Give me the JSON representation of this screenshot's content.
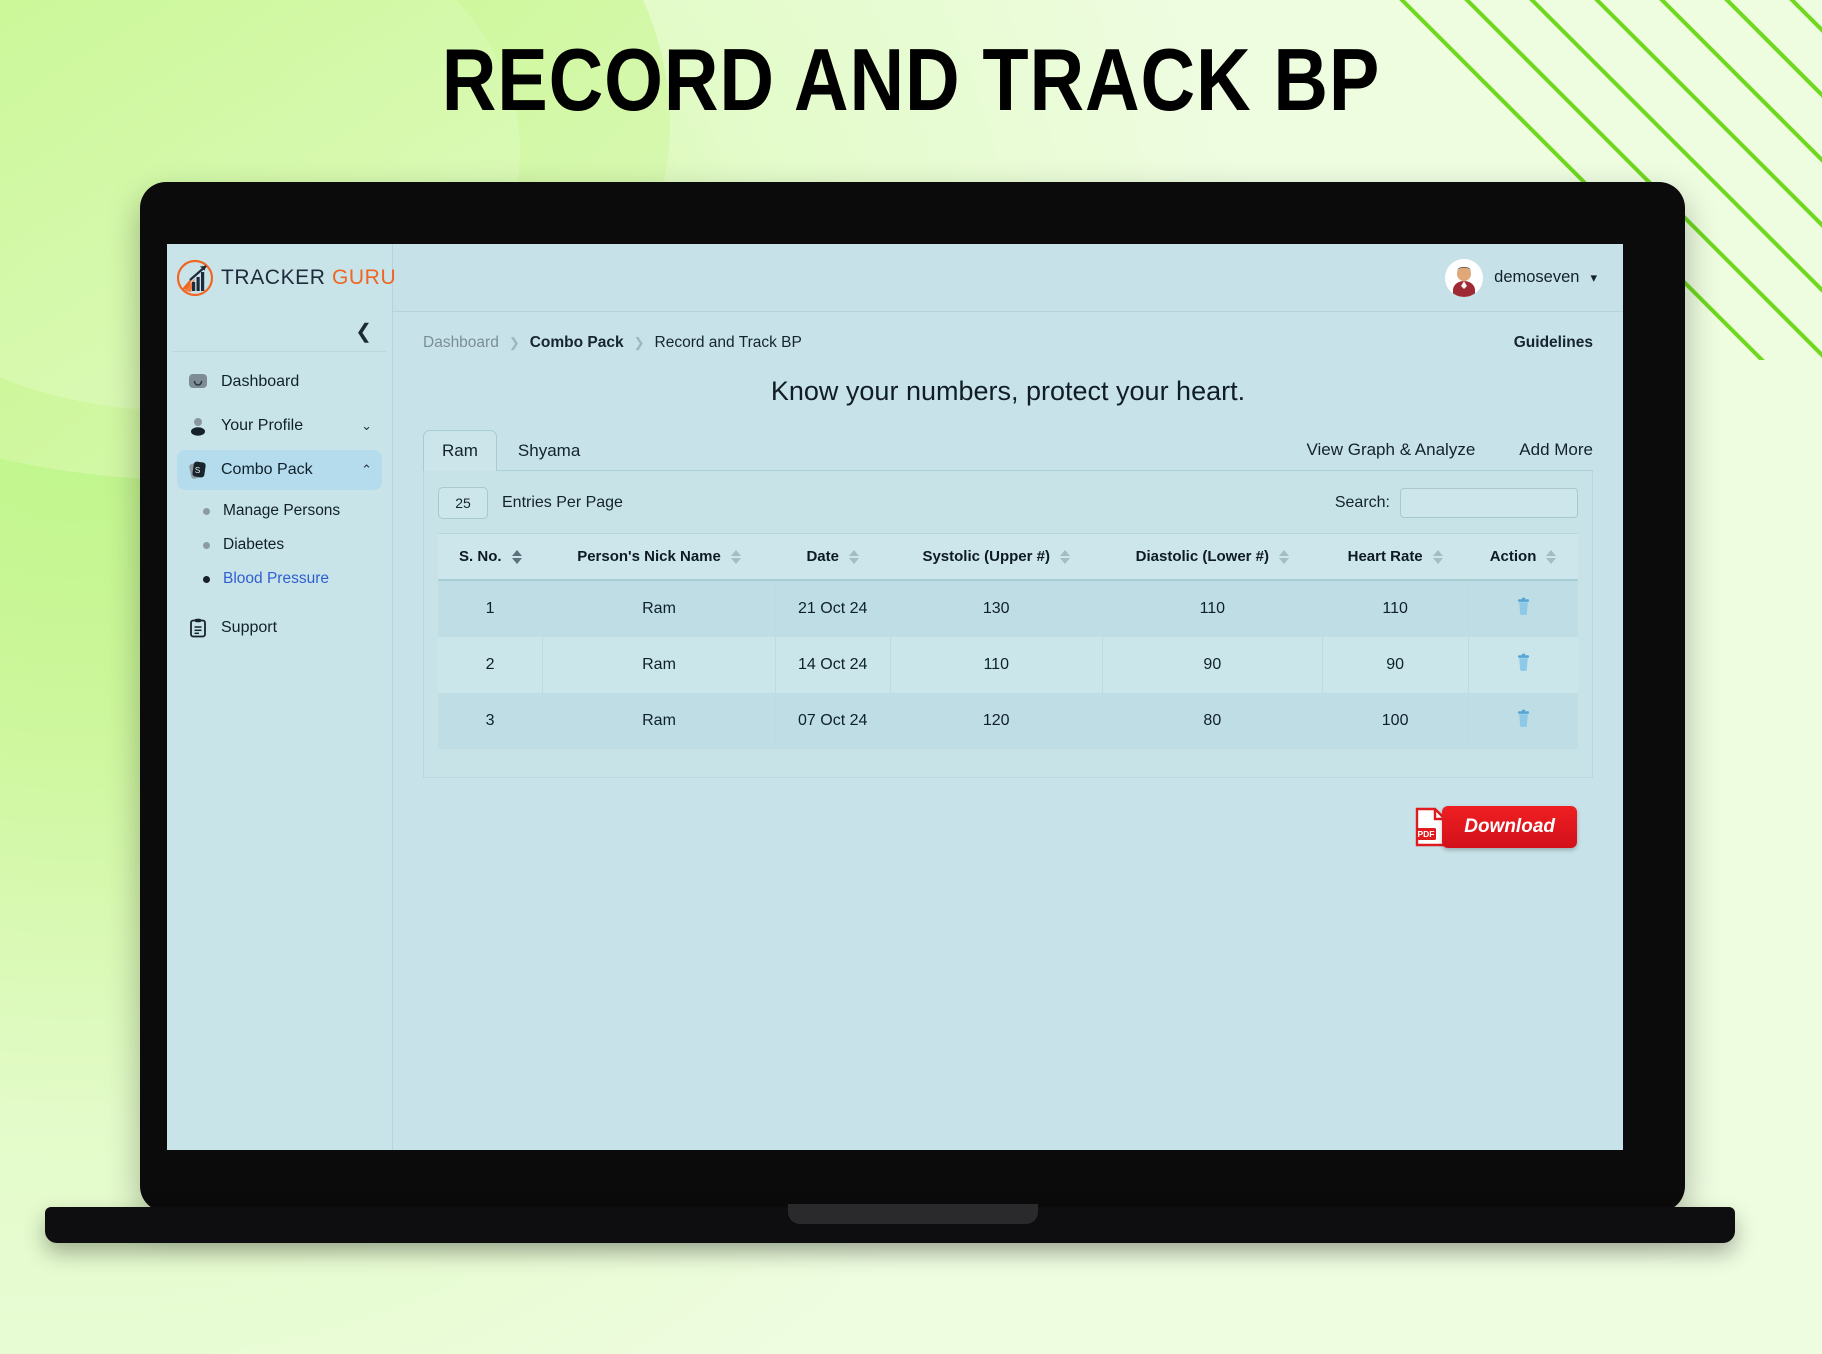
{
  "promo": {
    "title": "RECORD AND TRACK BP"
  },
  "brand": {
    "name_part1": "TRACKER",
    "name_part2": "GURU",
    "logo_icon": "chart-arrow-logo-icon",
    "color_primary": "#1d2b3a",
    "color_accent": "#f06522"
  },
  "topbar": {
    "user_name": "demoseven",
    "avatar_icon": "user-avatar",
    "caret_icon": "chevron-down-icon"
  },
  "sidebar": {
    "collapse_icon": "chevron-double-left-icon",
    "items": [
      {
        "label": "Dashboard",
        "icon": "dashboard-icon",
        "caret": "",
        "active": false
      },
      {
        "label": "Your Profile",
        "icon": "user-icon",
        "caret": "⌄",
        "active": false
      },
      {
        "label": "Combo Pack",
        "icon": "combo-pack-icon",
        "caret": "⌃",
        "active": true
      },
      {
        "label": "Support",
        "icon": "clipboard-icon",
        "caret": "",
        "active": false
      }
    ],
    "sub_items": [
      {
        "label": "Manage Persons",
        "active": false
      },
      {
        "label": "Diabetes",
        "active": false
      },
      {
        "label": "Blood Pressure",
        "active": true
      }
    ],
    "active_color": "#2f5fd0"
  },
  "breadcrumb": {
    "items": [
      {
        "label": "Dashboard",
        "style": "muted"
      },
      {
        "label": "Combo Pack",
        "style": "bold"
      },
      {
        "label": "Record and Track BP",
        "style": "plain"
      }
    ],
    "separator": "❯"
  },
  "page": {
    "guidelines_label": "Guidelines",
    "headline": "Know your numbers, protect your heart."
  },
  "tabs": [
    {
      "label": "Ram",
      "active": true
    },
    {
      "label": "Shyama",
      "active": false
    }
  ],
  "actions": [
    {
      "label": "View Graph & Analyze"
    },
    {
      "label": "Add More"
    }
  ],
  "table_controls": {
    "entries_value": "25",
    "entries_label": "Entries Per Page",
    "search_label": "Search:",
    "search_value": "",
    "search_placeholder": ""
  },
  "table": {
    "columns": [
      {
        "label": "S. No.",
        "sorted": true
      },
      {
        "label": "Person's Nick Name",
        "sorted": false
      },
      {
        "label": "Date",
        "sorted": false
      },
      {
        "label": "Systolic (Upper #)",
        "sorted": false
      },
      {
        "label": "Diastolic (Lower #)",
        "sorted": false
      },
      {
        "label": "Heart Rate",
        "sorted": false
      },
      {
        "label": "Action",
        "sorted": false
      }
    ],
    "rows": [
      {
        "sno": "1",
        "name": "Ram",
        "date": "21 Oct 24",
        "systolic": "130",
        "diastolic": "110",
        "heart_rate": "110",
        "action_icon": "trash-icon"
      },
      {
        "sno": "2",
        "name": "Ram",
        "date": "14 Oct 24",
        "systolic": "110",
        "diastolic": "90",
        "heart_rate": "90",
        "action_icon": "trash-icon"
      },
      {
        "sno": "3",
        "name": "Ram",
        "date": "07 Oct 24",
        "systolic": "120",
        "diastolic": "80",
        "heart_rate": "100",
        "action_icon": "trash-icon"
      }
    ]
  },
  "download": {
    "label": "Download",
    "icon": "pdf-file-icon",
    "icon_text": "PDF",
    "color": "#e01b1f"
  }
}
